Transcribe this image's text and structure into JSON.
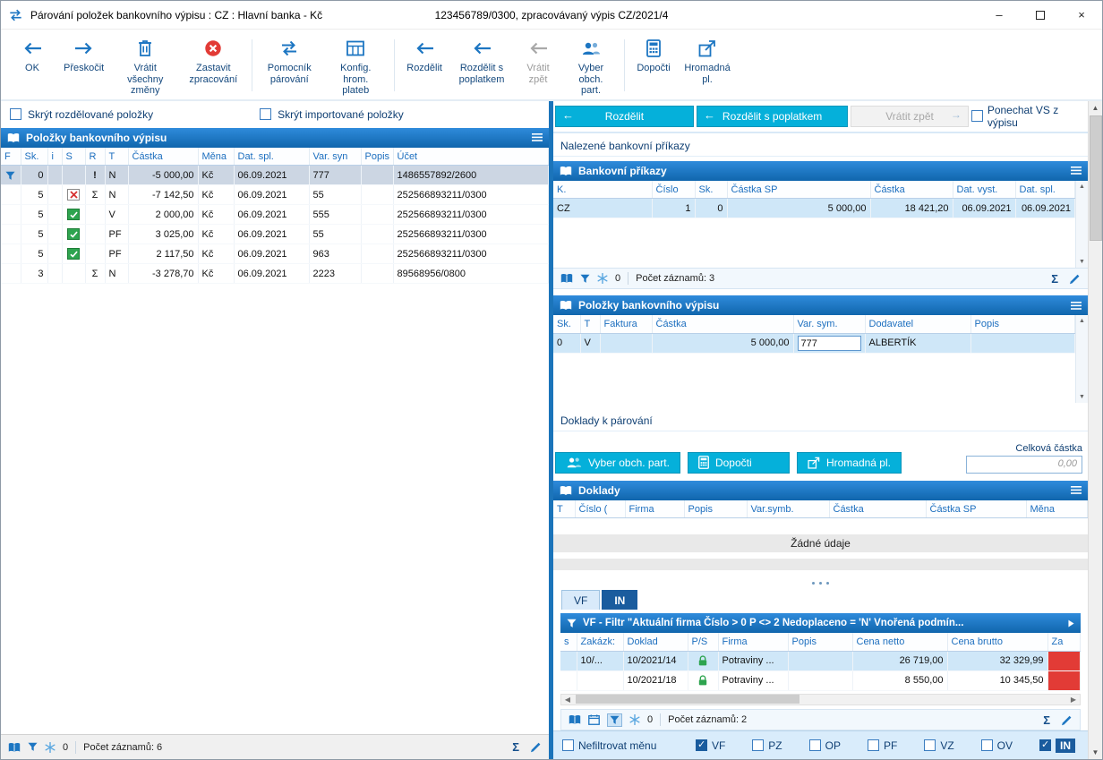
{
  "window": {
    "title": "Párování položek bankovního výpisu : CZ : Hlavní banka - Kč",
    "subtitle": "123456789/0300, zpracovávaný výpis CZ/2021/4",
    "controls": [
      "minimize",
      "maximize",
      "close"
    ]
  },
  "toolbar": {
    "buttons": {
      "ok": "OK",
      "skip": "Přeskočit",
      "revert_all": "Vrátit všechny změny",
      "stop": "Zastavit zpracování",
      "helper": "Pomocník párování",
      "config": "Konfig. hrom. plateb",
      "split": "Rozdělit",
      "split_fee": "Rozdělit s poplatkem",
      "undo": "Vrátit zpět",
      "partner": "Vyber obch. part.",
      "calc": "Dopočti",
      "bulk": "Hromadná pl."
    }
  },
  "left": {
    "hide_split_label": "Skrýt rozdělované položky",
    "hide_imported_label": "Skrýt importované položky",
    "panel_title": "Položky bankovního výpisu",
    "columns": {
      "f": "F",
      "sk": "Sk.",
      "i": "i",
      "s": "S",
      "r": "R",
      "t": "T",
      "castka": "Částka",
      "mena": "Měna",
      "dat": "Dat. spl.",
      "vs": "Var. syn",
      "popis": "Popis",
      "ucet": "Účet"
    },
    "rows": [
      {
        "f_icon": "filter-icon",
        "sk": "0",
        "s_icon": "",
        "r": "!",
        "t": "N",
        "castka": "-5 000,00",
        "mena": "Kč",
        "dat": "06.09.2021",
        "vs": "777",
        "ucet": "1486557892/2600"
      },
      {
        "f_icon": "",
        "sk": "5",
        "s_icon": "red-x-icon",
        "r": "Σ",
        "t": "N",
        "castka": "-7 142,50",
        "mena": "Kč",
        "dat": "06.09.2021",
        "vs": "55",
        "ucet": "252566893211/0300"
      },
      {
        "f_icon": "",
        "sk": "5",
        "s_icon": "green-check-icon",
        "r": "",
        "t": "V",
        "castka": "2 000,00",
        "mena": "Kč",
        "dat": "06.09.2021",
        "vs": "555",
        "ucet": "252566893211/0300"
      },
      {
        "f_icon": "",
        "sk": "5",
        "s_icon": "green-check-icon",
        "r": "",
        "t": "PF",
        "castka": "3 025,00",
        "mena": "Kč",
        "dat": "06.09.2021",
        "vs": "55",
        "ucet": "252566893211/0300"
      },
      {
        "f_icon": "",
        "sk": "5",
        "s_icon": "green-check-icon",
        "r": "",
        "t": "PF",
        "castka": "2 117,50",
        "mena": "Kč",
        "dat": "06.09.2021",
        "vs": "963",
        "ucet": "252566893211/0300"
      },
      {
        "f_icon": "",
        "sk": "3",
        "s_icon": "",
        "r": "Σ",
        "t": "N",
        "castka": "-3 278,70",
        "mena": "Kč",
        "dat": "06.09.2021",
        "vs": "2223",
        "ucet": "89568956/0800"
      }
    ],
    "status": {
      "zero": "0",
      "count": "Počet záznamů: 6"
    }
  },
  "right": {
    "actions": {
      "split": "Rozdělit",
      "split_fee": "Rozdělit s poplatkem",
      "undo": "Vrátit zpět",
      "keep_vs": "Ponechat VS z výpisu"
    },
    "orders_section_label": "Nalezené bankovní příkazy",
    "orders": {
      "title": "Bankovní příkazy",
      "columns": {
        "k": "K.",
        "cislo": "Číslo",
        "sk": "Sk.",
        "castka_sp": "Částka SP",
        "castka": "Částka",
        "dat_vyst": "Dat. vyst.",
        "dat_spl": "Dat. spl."
      },
      "row": {
        "k": "CZ",
        "cislo": "1",
        "sk": "0",
        "castka_sp": "5 000,00",
        "castka": "18 421,20",
        "dat_vyst": "06.09.2021",
        "dat_spl": "06.09.2021"
      },
      "status": {
        "zero": "0",
        "count": "Počet záznamů: 3"
      }
    },
    "items": {
      "title": "Položky bankovního výpisu",
      "columns": {
        "sk": "Sk.",
        "t": "T",
        "faktura": "Faktura",
        "castka": "Částka",
        "vs": "Var. sym.",
        "dodavatel": "Dodavatel",
        "popis": "Popis"
      },
      "row": {
        "sk": "0",
        "t": "V",
        "castka": "5 000,00",
        "vs": "777",
        "dodavatel": "ALBERTÍK"
      }
    },
    "pairing_section_label": "Doklady k párování",
    "pairing": {
      "partner_btn": "Vyber obch. part.",
      "calc_btn": "Dopočti",
      "bulk_btn": "Hromadná pl.",
      "total_label": "Celková částka",
      "total_value": "0,00"
    },
    "documents": {
      "title": "Doklady",
      "columns": {
        "t": "T",
        "cislo": "Číslo (",
        "firma": "Firma",
        "popis": "Popis",
        "vs": "Var.symb.",
        "castka": "Částka",
        "castka_sp": "Částka SP",
        "mena": "Měna"
      },
      "empty_text": "Žádné údaje"
    },
    "tabs": {
      "vf": "VF",
      "in": "IN"
    },
    "filter_text": "VF - Filtr \"Aktuální firma  Číslo > 0  P <> 2  Nedoplaceno = 'N'  Vnořená podmín...",
    "invoices": {
      "columns": {
        "s": "s",
        "zakazka": "Zakázk:",
        "doklad": "Doklad",
        "ps": "P/S",
        "firma": "Firma",
        "popis": "Popis",
        "netto": "Cena netto",
        "brutto": "Cena brutto",
        "za": "Za"
      },
      "rows": [
        {
          "zakazka": "10/...",
          "doklad": "10/2021/14",
          "ps_icon": "green-lock-icon",
          "firma": "Potraviny ...",
          "netto": "26 719,00",
          "brutto": "32 329,99"
        },
        {
          "zakazka": "",
          "doklad": "10/2021/18",
          "ps_icon": "green-lock-icon",
          "firma": "Potraviny ...",
          "netto": "8 550,00",
          "brutto": "10 345,50"
        }
      ],
      "status": {
        "zero": "0",
        "count": "Počet záznamů: 2"
      }
    },
    "bottom": {
      "no_currency_filter": "Nefiltrovat měnu",
      "vf": "VF",
      "pz": "PZ",
      "op": "OP",
      "pf": "PF",
      "vz": "VZ",
      "ov": "OV",
      "in": "IN"
    }
  }
}
